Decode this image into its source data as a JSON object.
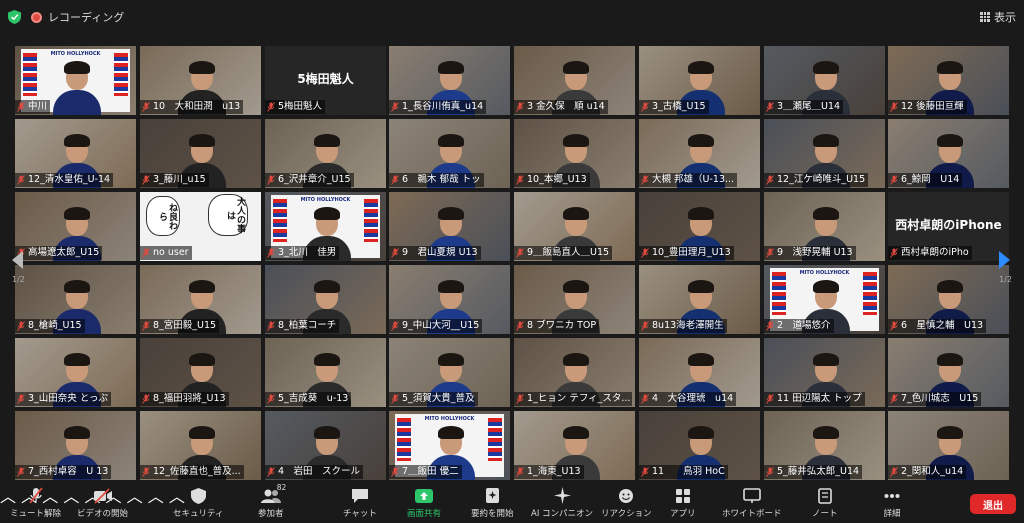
{
  "header": {
    "recording_label": "レコーディング",
    "view_label": "表示"
  },
  "pagination": {
    "left": "1/2",
    "right": "1/2"
  },
  "banner_text": "MITO HOLLYHOCK",
  "gallery": [
    {
      "name": "中川",
      "kind": "banner"
    },
    {
      "name": "10　大和田潤　u13"
    },
    {
      "name": "5梅田魁人",
      "kind": "text",
      "big": "5梅田魁人"
    },
    {
      "name": "1_長谷川侑真_u14",
      "active": true
    },
    {
      "name": "3 金久保　順 u14"
    },
    {
      "name": "3_古橋_U15"
    },
    {
      "name": "3＿瀬尾＿U14"
    },
    {
      "name": "12 後藤田亘輝"
    },
    {
      "name": "12_清水皇佑_U-14"
    },
    {
      "name": "3_藤川_u15"
    },
    {
      "name": "6_沢井章介_U15"
    },
    {
      "name": "6　鵜木 郁哉 トッ"
    },
    {
      "name": "10_本郷_U13"
    },
    {
      "name": "大槻 邦雄（U-13..."
    },
    {
      "name": "12_江ケ崎唯斗_U15"
    },
    {
      "name": "6_鯨岡　U14"
    },
    {
      "name": "高場遼太郎_U15"
    },
    {
      "name": "no user",
      "kind": "manga",
      "bub1": "ね良わら",
      "bub2": "大人の事は"
    },
    {
      "name": "3_北川　佳男",
      "kind": "banner"
    },
    {
      "name": "9　君山夏規 U13"
    },
    {
      "name": "9＿飯島直人＿U15"
    },
    {
      "name": "10_豊田理月_U13"
    },
    {
      "name": "9　浅野晃輔 U13"
    },
    {
      "name": "西村卓朗のiPho",
      "kind": "text",
      "big": "西村卓朗のiPhone"
    },
    {
      "name": "8_槍崎_U15"
    },
    {
      "name": "8_宮田毅_U15"
    },
    {
      "name": "8_柏葉コーチ"
    },
    {
      "name": "9_中山大河__U15"
    },
    {
      "name": "8 ブワニカ TOP"
    },
    {
      "name": "8u13海老澤開生"
    },
    {
      "name": "2　道場悠介",
      "kind": "banner"
    },
    {
      "name": "6　星慎之輔　U13"
    },
    {
      "name": "3_山田奈央 とっぷ"
    },
    {
      "name": "8_福田羽將_U13"
    },
    {
      "name": "5_吉成葵　u-13"
    },
    {
      "name": "5_須賀大貴_普及"
    },
    {
      "name": "1_ヒョン テフィ_スタ..."
    },
    {
      "name": "4　大谷理琥　u14"
    },
    {
      "name": "11 田辺陽太 トップ"
    },
    {
      "name": "7_色川城志　U15"
    },
    {
      "name": "7_西村卓容　U 13"
    },
    {
      "name": "12_佐藤直也_普及..."
    },
    {
      "name": "4　岩田　スクール"
    },
    {
      "name": "7＿飯田 優二",
      "kind": "banner"
    },
    {
      "name": "1_海東_U13"
    },
    {
      "name": "11　　鳥羽 HoC"
    },
    {
      "name": "5_藤井弘太郎_U14"
    },
    {
      "name": "2_関和人_u14"
    }
  ],
  "toolbar": {
    "mute": "ミュート解除",
    "video": "ビデオの開始",
    "security": "セキュリティ",
    "participants": "参加者",
    "participants_count": "82",
    "chat": "チャット",
    "share": "画面共有",
    "summary": "要約を開始",
    "companion": "AI コンパニオン",
    "reactions": "リアクション",
    "apps": "アプリ",
    "whiteboard": "ホワイトボード",
    "notes": "ノート",
    "more": "詳細",
    "leave": "退出"
  },
  "colors": {
    "share_green": "#2ec56a",
    "leave_red": "#e02828",
    "active_speaker": "#c9d24a",
    "muted_red": "#e04a3f"
  }
}
